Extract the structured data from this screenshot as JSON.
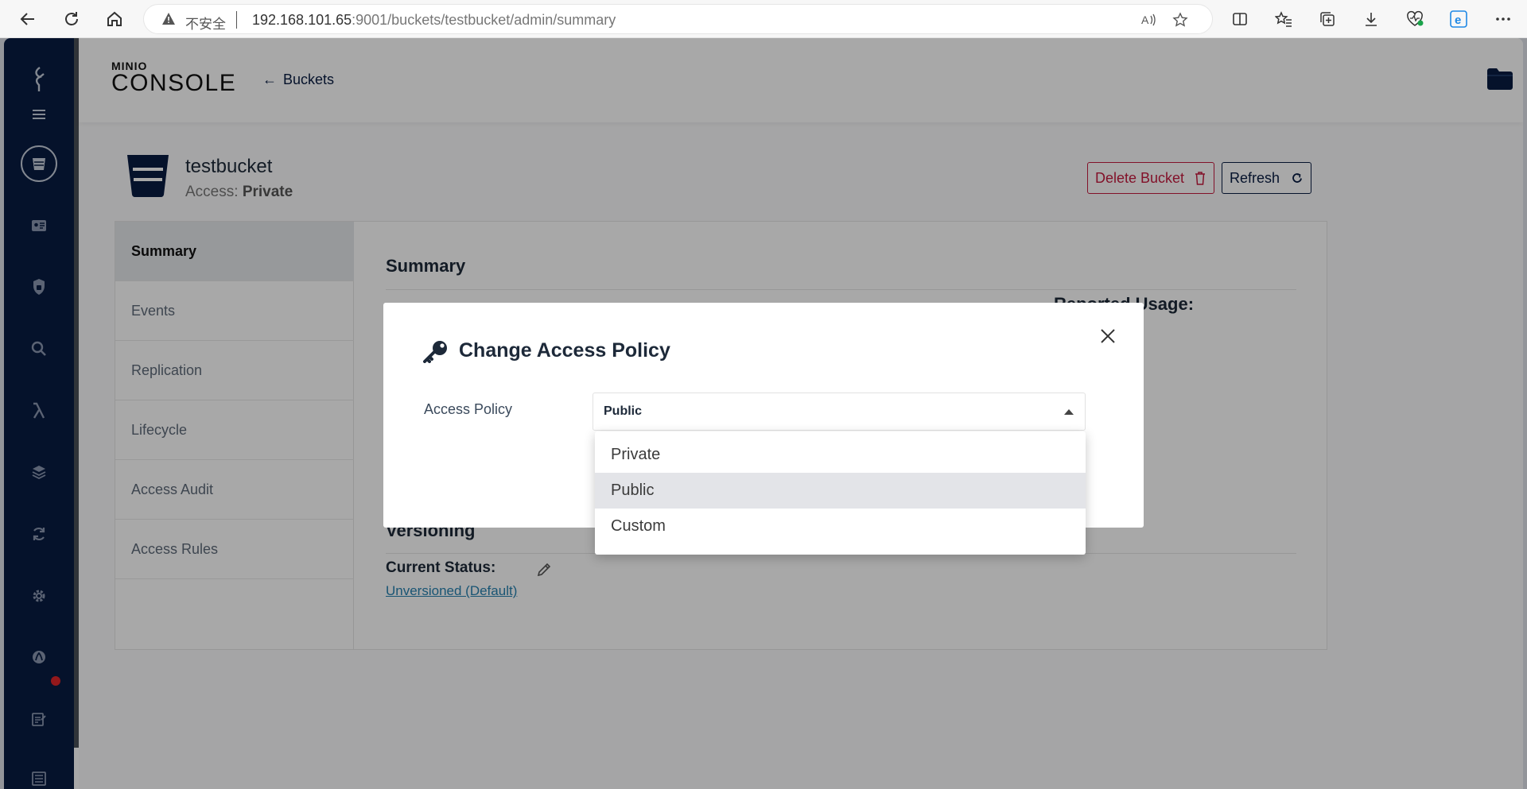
{
  "browser": {
    "insecure_label": "不安全",
    "url_host": "192.168.101.65",
    "url_rest": ":9001/buckets/testbucket/admin/summary"
  },
  "header": {
    "logo_small": "MINIO",
    "logo_big": "CONSOLE",
    "back_label": "Buckets"
  },
  "bucket": {
    "name": "testbucket",
    "access_prefix": "Access: ",
    "access_value": "Private",
    "delete_label": "Delete Bucket",
    "refresh_label": "Refresh"
  },
  "tabs": [
    {
      "label": "Summary",
      "active": true
    },
    {
      "label": "Events"
    },
    {
      "label": "Replication"
    },
    {
      "label": "Lifecycle"
    },
    {
      "label": "Access Audit"
    },
    {
      "label": "Access Rules"
    }
  ],
  "summary": {
    "title": "Summary",
    "reported_usage": "Reported Usage:",
    "versioning_title": "Versioning",
    "current_status_label": "Current Status:",
    "current_status_value": "Unversioned (Default)"
  },
  "modal": {
    "title": "Change Access Policy",
    "field_label": "Access Policy",
    "selected_value": "Public",
    "options": [
      "Private",
      "Public",
      "Custom"
    ]
  },
  "colors": {
    "sidebar_bg": "#081c42",
    "danger": "#c51b3f",
    "link": "#2781b0"
  }
}
